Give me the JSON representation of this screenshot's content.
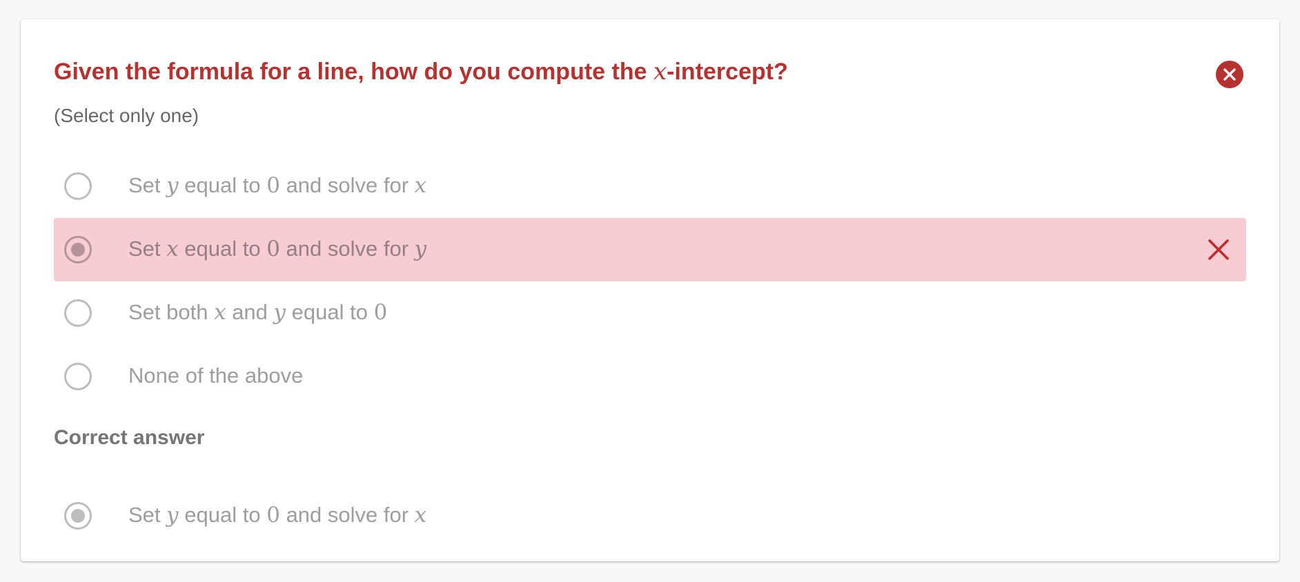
{
  "question": {
    "prefix": "Given the formula for a line, how do you compute the ",
    "math_var": "x",
    "suffix": "-intercept?"
  },
  "instruction": "(Select only one)",
  "options": [
    {
      "parts": [
        "Set ",
        "y",
        " equal to ",
        "0",
        " and solve for ",
        "x"
      ],
      "selected": false,
      "state": "neutral"
    },
    {
      "parts": [
        "Set ",
        "x",
        " equal to ",
        "0",
        " and solve for ",
        "y"
      ],
      "selected": true,
      "state": "incorrect"
    },
    {
      "parts": [
        "Set both ",
        "x",
        " and ",
        "y",
        " equal to ",
        "0"
      ],
      "selected": false,
      "state": "neutral"
    },
    {
      "parts": [
        "None of the above"
      ],
      "selected": false,
      "state": "neutral"
    }
  ],
  "correct_answer": {
    "heading": "Correct answer",
    "parts": [
      "Set ",
      "y",
      " equal to ",
      "0",
      " and solve for ",
      "x"
    ]
  },
  "icons": {
    "close": "close-circle-icon",
    "incorrect": "x-mark-icon"
  },
  "colors": {
    "accent": "#b5322f",
    "incorrect_bg": "#f7ccd2",
    "text_muted": "#9e9e9e"
  }
}
